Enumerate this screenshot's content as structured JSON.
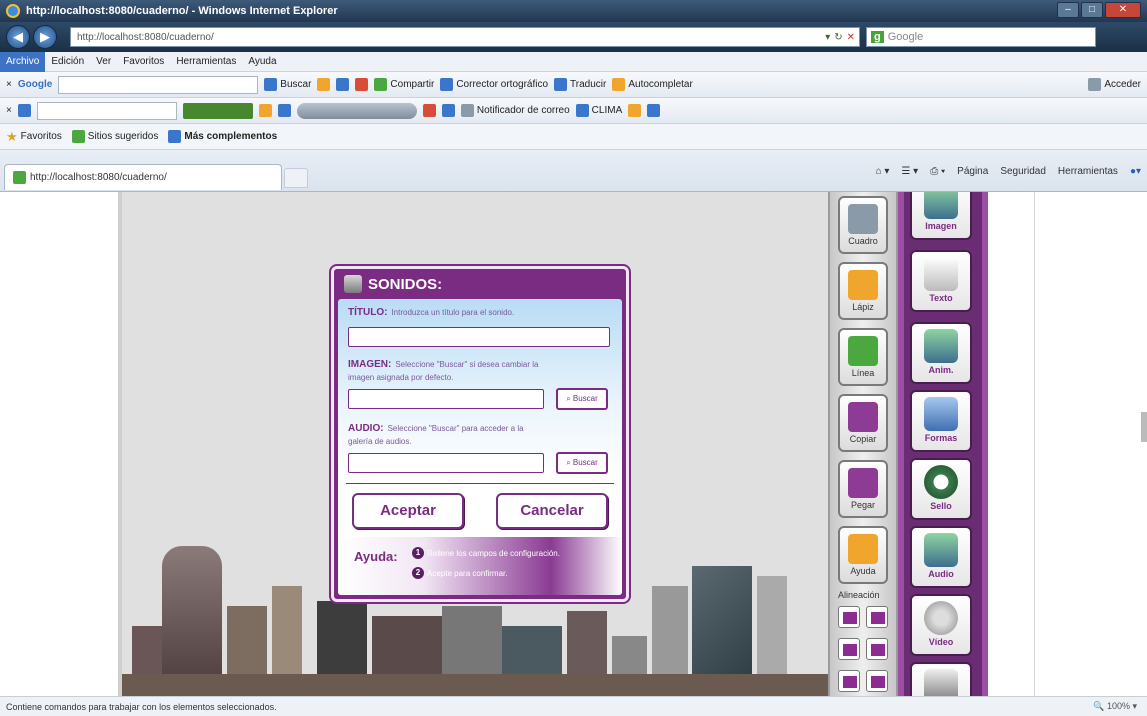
{
  "window": {
    "title": "http://localhost:8080/cuaderno/ - Windows Internet Explorer"
  },
  "address_bar": {
    "url": "http://localhost:8080/cuaderno/",
    "search_placeholder": "Google"
  },
  "menu": [
    "Archivo",
    "Edición",
    "Ver",
    "Favoritos",
    "Herramientas",
    "Ayuda"
  ],
  "google_toolbar": {
    "label": "Google",
    "items": [
      "Buscar",
      "Compartir",
      "Corrector ortográfico",
      "Traducir",
      "Autocompletar",
      "Acceder"
    ]
  },
  "toolbar2": {
    "items": [
      "Notificador de correo",
      "CLIMA"
    ]
  },
  "favorites_bar": {
    "favorites": "Favoritos",
    "suggested": "Sitios sugeridos",
    "more": "Más complementos"
  },
  "tab": {
    "title": "http://localhost:8080/cuaderno/"
  },
  "command_bar": [
    "Página",
    "Seguridad",
    "Herramientas"
  ],
  "tools": [
    {
      "label": "Cuadro"
    },
    {
      "label": "Lápiz"
    },
    {
      "label": "Línea"
    },
    {
      "label": "Copiar"
    },
    {
      "label": "Pegar"
    },
    {
      "label": "Ayuda"
    }
  ],
  "align_label": "Alineación",
  "media": [
    {
      "label": "Imagen"
    },
    {
      "label": "Texto"
    },
    {
      "label": "Anim."
    },
    {
      "label": "Formas"
    },
    {
      "label": "Sello"
    },
    {
      "label": "Audio"
    },
    {
      "label": "Vídeo"
    }
  ],
  "dialog": {
    "title": "SONIDOS:",
    "titulo_label": "TÍTULO:",
    "titulo_hint": "Introduzca un título para el sonido.",
    "imagen_label": "IMAGEN:",
    "imagen_hint": "Seleccione \"Buscar\" si desea cambiar la",
    "imagen_hint2": "imagen asignada por defecto.",
    "audio_label": "AUDIO:",
    "audio_hint": "Seleccione \"Buscar\" para acceder a la",
    "audio_hint2": "galería de audios.",
    "browse_label": "Buscar",
    "accept_label": "Aceptar",
    "cancel_label": "Cancelar",
    "help_label": "Ayuda:",
    "help_items": [
      "Rellene los campos de configuración.",
      "Acepte para confirmar."
    ]
  },
  "status": {
    "text": "Contiene comandos para trabajar con los elementos seleccionados.",
    "zoom": "100%"
  },
  "colors": {
    "accent": "#7a2b82",
    "dialog_body": "#e9f4fc",
    "ie_frame": "#22374f"
  }
}
